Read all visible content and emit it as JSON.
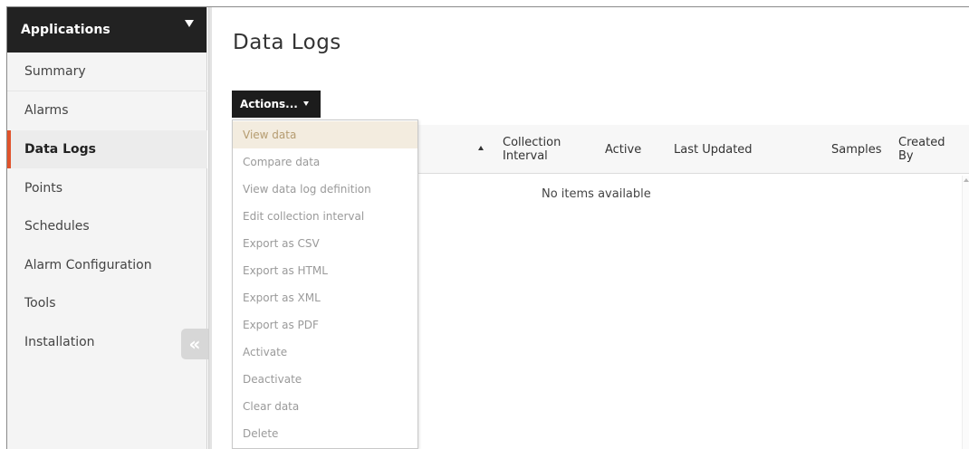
{
  "sidebar": {
    "header_title": "Applications",
    "items": [
      {
        "label": "Summary"
      },
      {
        "label": "Alarms"
      },
      {
        "label": "Data Logs"
      },
      {
        "label": "Points"
      },
      {
        "label": "Schedules"
      },
      {
        "label": "Alarm Configuration"
      },
      {
        "label": "Tools"
      },
      {
        "label": "Installation"
      }
    ],
    "active_item": "Data Logs",
    "collapse_glyph": "«"
  },
  "main": {
    "title": "Data Logs",
    "actions_label": "Actions..."
  },
  "grid": {
    "columns": [
      {
        "label": "Collection Interval"
      },
      {
        "label": "Active"
      },
      {
        "label": "Last Updated"
      },
      {
        "label": "Samples"
      },
      {
        "label": "Created By"
      }
    ],
    "empty_message": "No items available"
  },
  "actions_menu": {
    "items": [
      {
        "label": "View data"
      },
      {
        "label": "Compare data"
      },
      {
        "label": "View data log definition"
      },
      {
        "label": "Edit collection interval"
      },
      {
        "label": "Export as CSV"
      },
      {
        "label": "Export as HTML"
      },
      {
        "label": "Export as XML"
      },
      {
        "label": "Export as PDF"
      },
      {
        "label": "Activate"
      },
      {
        "label": "Deactivate"
      },
      {
        "label": "Clear data"
      },
      {
        "label": "Delete"
      }
    ],
    "highlighted_item": "View data"
  },
  "colors": {
    "sidebar_header_bg": "#222222",
    "active_accent": "#e0532b",
    "actions_button_bg": "#1c1c1c",
    "menu_highlight_bg": "#f3ecdf"
  }
}
